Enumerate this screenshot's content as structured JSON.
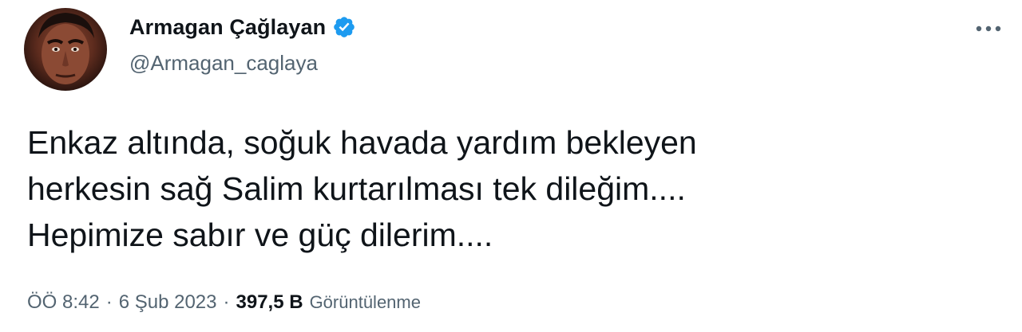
{
  "author": {
    "display_name": "Armagan Çağlayan",
    "handle": "@Armagan_caglaya",
    "verified_color": "#1d9bf0"
  },
  "tweet": {
    "lines": [
      "Enkaz altında, soğuk havada yardım bekleyen",
      "herkesin sağ Salim kurtarılması tek dileğim....",
      "Hepimize sabır ve güç dilerim...."
    ]
  },
  "meta": {
    "time": "ÖÖ 8:42",
    "separator": "·",
    "date": "6 Şub 2023",
    "views_count": "397,5 B",
    "views_label": "Görüntülenme"
  },
  "icons": {
    "more": "more-horizontal-icon",
    "verified": "verified-badge-icon"
  }
}
